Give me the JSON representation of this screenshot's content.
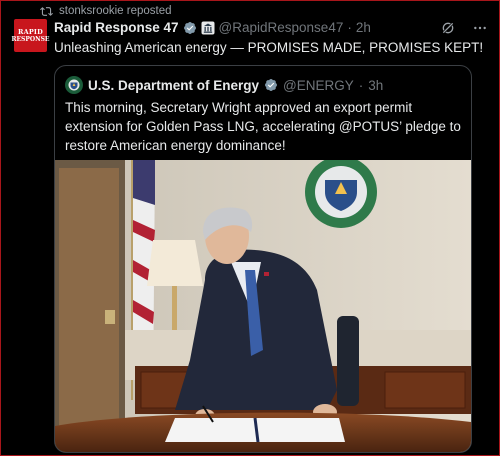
{
  "repost": {
    "text": "stonksrookie reposted"
  },
  "tweet": {
    "avatar_line1": "RAPID",
    "avatar_line2": "RESPONSE",
    "name": "Rapid Response 47",
    "handle": "@RapidResponse47",
    "time": "2h",
    "text": "Unleashing American energy — PROMISES MADE, PROMISES KEPT!"
  },
  "quote": {
    "name": "U.S. Department of Energy",
    "handle": "@ENERGY",
    "time": "3h",
    "text": "This morning, Secretary Wright approved an export permit extension for Golden Pass LNG, accelerating @POTUS’ pledge to restore American energy dominance!"
  },
  "icons": [
    "repost-icon",
    "verified-badge-icon",
    "government-badge-icon",
    "grok-icon",
    "more-icon"
  ],
  "colors": {
    "accent_red": "#c8161d",
    "verified_blue": "#1d9bf0",
    "gov_grey": "#829aab"
  }
}
